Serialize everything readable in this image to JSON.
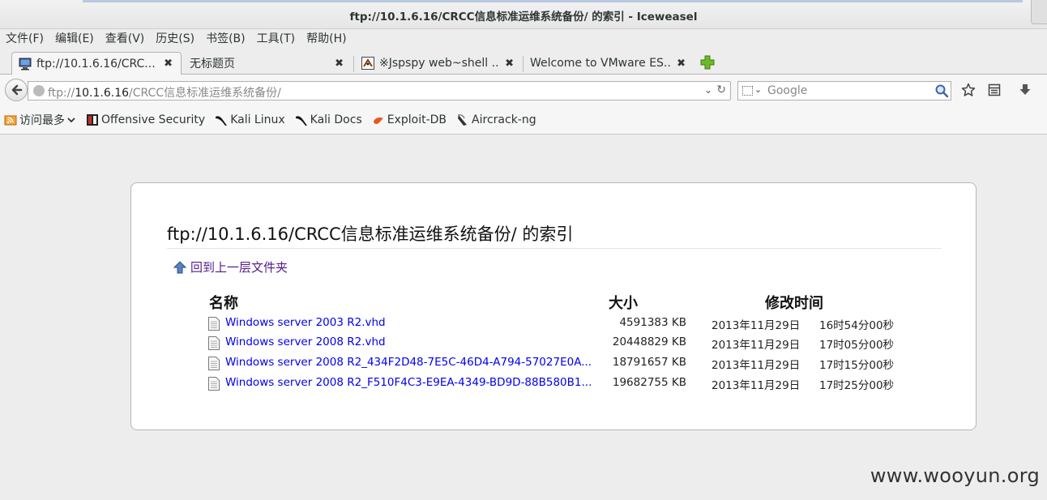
{
  "window": {
    "title": "ftp://10.1.6.16/CRCC信息标准运维系统备份/ 的索引 - Iceweasel"
  },
  "menubar": [
    "文件(F)",
    "编辑(E)",
    "查看(V)",
    "历史(S)",
    "书签(B)",
    "工具(T)",
    "帮助(H)"
  ],
  "tabs": [
    {
      "label": "ftp://10.1.6.16/CRC...",
      "icon": "monitor-icon",
      "active": true
    },
    {
      "label": "无标题页",
      "icon": "none",
      "active": false
    },
    {
      "label": "※Jspspy web~shell ...",
      "icon": "shell-icon",
      "active": false
    },
    {
      "label": "Welcome to VMware ES...",
      "icon": "none",
      "active": false
    }
  ],
  "tab_close_glyph": "✖",
  "navbar": {
    "url_scheme": "ftp://",
    "url_host": "10.1.6.16",
    "url_path": "/CRCC信息标准运维系统备份/",
    "search_placeholder": "Google"
  },
  "bookmarks": [
    {
      "label": "访问最多",
      "icon": "rss-folder-icon",
      "dropdown": true
    },
    {
      "label": "Offensive Security",
      "icon": "offsec-icon"
    },
    {
      "label": "Kali Linux",
      "icon": "kali-dragon-icon"
    },
    {
      "label": "Kali Docs",
      "icon": "kali-dragon-icon"
    },
    {
      "label": "Exploit-DB",
      "icon": "exploitdb-icon"
    },
    {
      "label": "Aircrack-ng",
      "icon": "aircrack-icon"
    }
  ],
  "listing": {
    "heading": "ftp://10.1.6.16/CRCC信息标准运维系统备份/ 的索引",
    "up_link": "回到上一层文件夹",
    "columns": {
      "name": "名称",
      "size": "大小",
      "modified": "修改时间"
    },
    "files": [
      {
        "name": "Windows server 2003 R2.vhd",
        "size": "4591383 KB",
        "date": "2013年11月29日",
        "time": "16时54分00秒"
      },
      {
        "name": "Windows server 2008 R2.vhd",
        "size": "20448829 KB",
        "date": "2013年11月29日",
        "time": "17时05分00秒"
      },
      {
        "name": "Windows server 2008 R2_434F2D48-7E5C-46D4-A794-57027E0A...",
        "size": "18791657 KB",
        "date": "2013年11月29日",
        "time": "17时15分00秒"
      },
      {
        "name": "Windows server 2008 R2_F510F4C3-E9EA-4349-BD9D-88B580B1...",
        "size": "19682755 KB",
        "date": "2013年11月29日",
        "time": "17时25分00秒"
      }
    ]
  },
  "watermark": "www.wooyun.org",
  "colors": {
    "link": "#0000ee",
    "visited": "#551a8b",
    "accent_plus": "#4e9a06"
  }
}
